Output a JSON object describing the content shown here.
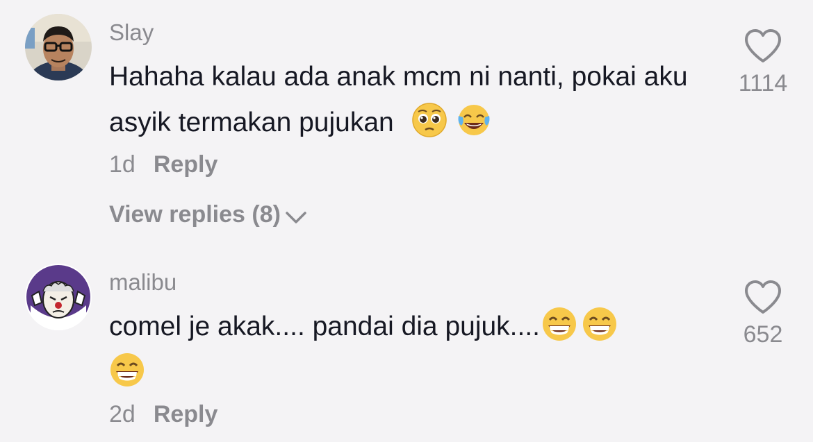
{
  "comments": [
    {
      "username": "Slay",
      "text": "Hahaha kalau ada anak mcm ni nanti, pokai aku asyik termakan pujukan",
      "emojis": [
        "pleading-face",
        "tears-of-joy"
      ],
      "time": "1d",
      "reply_label": "Reply",
      "view_replies": "View replies (8)",
      "likes": "1114"
    },
    {
      "username": "malibu",
      "text": "comel je akak.... pandai dia pujuk....",
      "emojis": [
        "grinning-face",
        "grinning-face",
        "grinning-face"
      ],
      "time": "2d",
      "reply_label": "Reply",
      "likes": "652"
    }
  ],
  "colors": {
    "background": "#f4f3f5",
    "text": "#161823",
    "muted": "#8a8a8f"
  }
}
